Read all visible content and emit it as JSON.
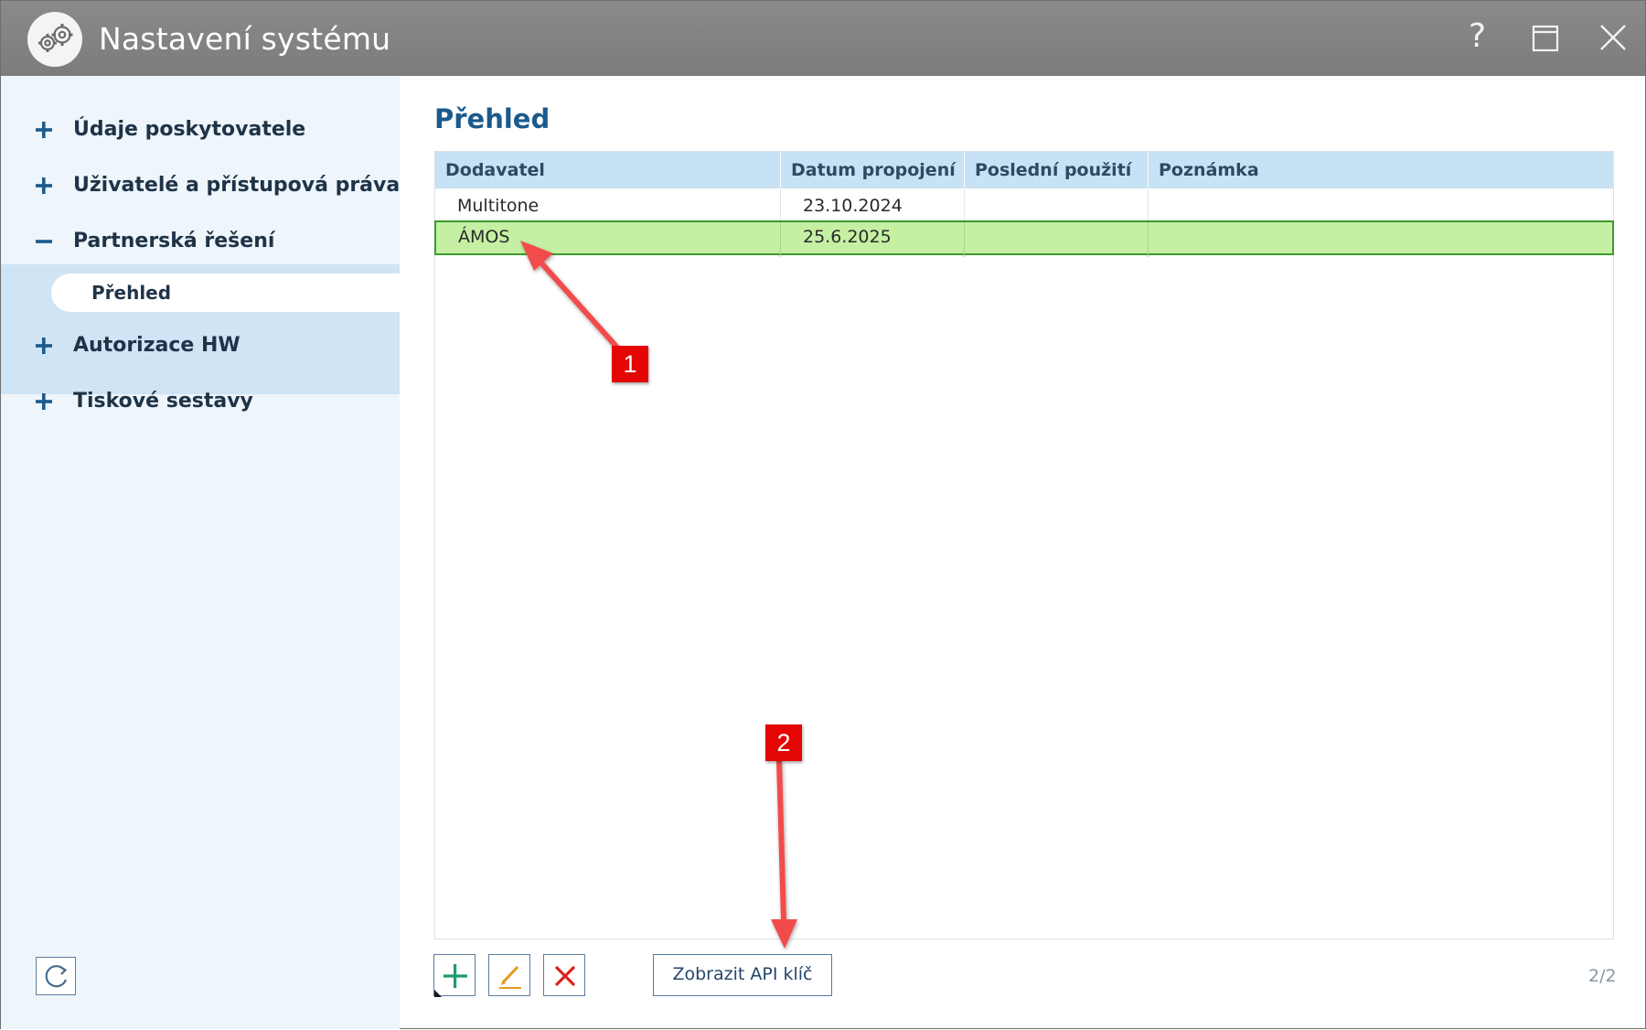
{
  "window": {
    "title": "Nastavení systému",
    "help_glyph": "?"
  },
  "sidebar": {
    "items": [
      {
        "label": "Údaje poskytovatele",
        "sign": "plus",
        "expanded": false
      },
      {
        "label": "Uživatelé a přístupová práva",
        "sign": "plus",
        "expanded": false
      },
      {
        "label": "Partnerská řešení",
        "sign": "minus",
        "expanded": true
      },
      {
        "label": "Autorizace HW",
        "sign": "plus",
        "expanded": false
      },
      {
        "label": "Tiskové sestavy",
        "sign": "plus",
        "expanded": false
      }
    ],
    "subitems": [
      {
        "label": "Přehled",
        "selected": true
      }
    ],
    "refresh_icon": "refresh-icon"
  },
  "main": {
    "title": "Přehled",
    "table": {
      "columns": [
        "Dodavatel",
        "Datum propojení",
        "Poslední použití",
        "Poznámka"
      ],
      "rows": [
        {
          "dodavatel": "Multitone",
          "datum": "23.10.2024",
          "posledni": "",
          "poznamka": "",
          "selected": false
        },
        {
          "dodavatel": "ÁMOS",
          "datum": "25.6.2025",
          "posledni": "",
          "poznamka": "",
          "selected": true
        }
      ]
    },
    "toolbar": {
      "add_icon": "plus-icon",
      "edit_icon": "pencil-icon",
      "delete_icon": "x-icon",
      "api_button": "Zobrazit API klíč",
      "page_count": "2/2"
    }
  },
  "annotations": {
    "badge1": "1",
    "badge2": "2"
  },
  "colors": {
    "titlebar": "#838383",
    "sidebar_bg": "#eef5fb",
    "sidebar_active": "#cfe4f5",
    "header_bg": "#c7e2f4",
    "selected_row": "#c5f0a4",
    "selected_border": "#3d9a2f",
    "heading": "#1b5a8c",
    "badge": "#e40505"
  }
}
